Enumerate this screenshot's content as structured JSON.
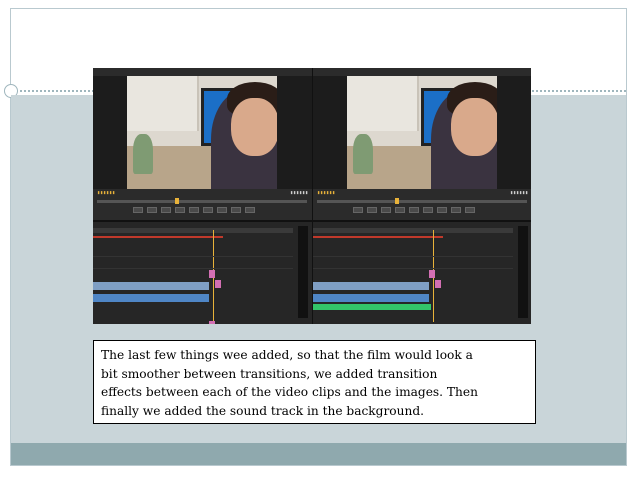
{
  "slide": {
    "caption": "The last few things wee added, so that the film would look a\nbit smoother between transitions, we added transition\neffects between each of the video clips and the images. Then\nfinally we added the sound track in the background."
  },
  "colors": {
    "body_background": "#c9d5d9",
    "footer_band": "#8fa9ae",
    "timecode": "#e8b23a",
    "video_clip": "#6e8fb5",
    "transition_clip": "#d36fb3",
    "audio_clip": "#33c46a"
  },
  "screenshot": {
    "description_icons": [
      "video-frame",
      "timeline",
      "audio-meter"
    ]
  }
}
